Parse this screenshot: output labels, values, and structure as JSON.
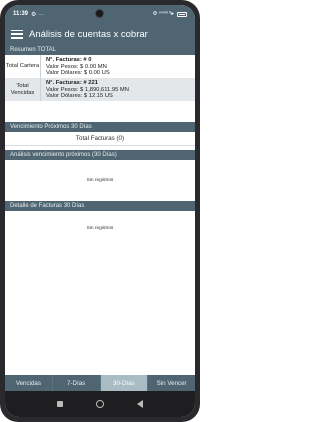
{
  "status": {
    "time": "11:39",
    "extra": "⚙ ···",
    "right": "⚙ ᵛᵒ⁴ᴳ ᴵᴵ▸"
  },
  "app": {
    "title": "Análisis de cuentas x cobrar"
  },
  "resumen": {
    "header": "Resumen TOTAL",
    "rows": [
      {
        "label": "Total Cartera",
        "facturas": "N°. Facturas: # 0",
        "pesos": "Valor Pesos: $ 0.00 MN",
        "dolares": "Valor Dólares: $ 0.00 US"
      },
      {
        "label": "Total Vencidas",
        "facturas": "N°. Facturas: # 221",
        "pesos": "Valor Pesos: $ 1,890,611.95 MN",
        "dolares": "Valor Dólares: $ 12.15 US"
      }
    ]
  },
  "vencimiento": {
    "header": "Vencimiento Próximos 30 Días",
    "total_facturas": "Total Facturas (0)"
  },
  "analisis": {
    "header": "Análisis vencimiento próximos (30 Días)",
    "empty": "Sin registros"
  },
  "detalle": {
    "header": "Detalle de Facturas 30 Días",
    "empty": "Sin registros"
  },
  "tabs": [
    {
      "label": "Vencidas",
      "active": false
    },
    {
      "label": "7-Días",
      "active": false
    },
    {
      "label": "30-Días",
      "active": true
    },
    {
      "label": "Sin Vencer",
      "active": false
    }
  ],
  "colors": {
    "primary": "#4f6672",
    "active_tab": "#a9bbc3",
    "alt_row": "#e3e7e9"
  },
  "icons": {
    "menu": "hamburger-icon",
    "nav_recent": "square-icon",
    "nav_home": "circle-icon",
    "nav_back": "triangle-back-icon"
  }
}
